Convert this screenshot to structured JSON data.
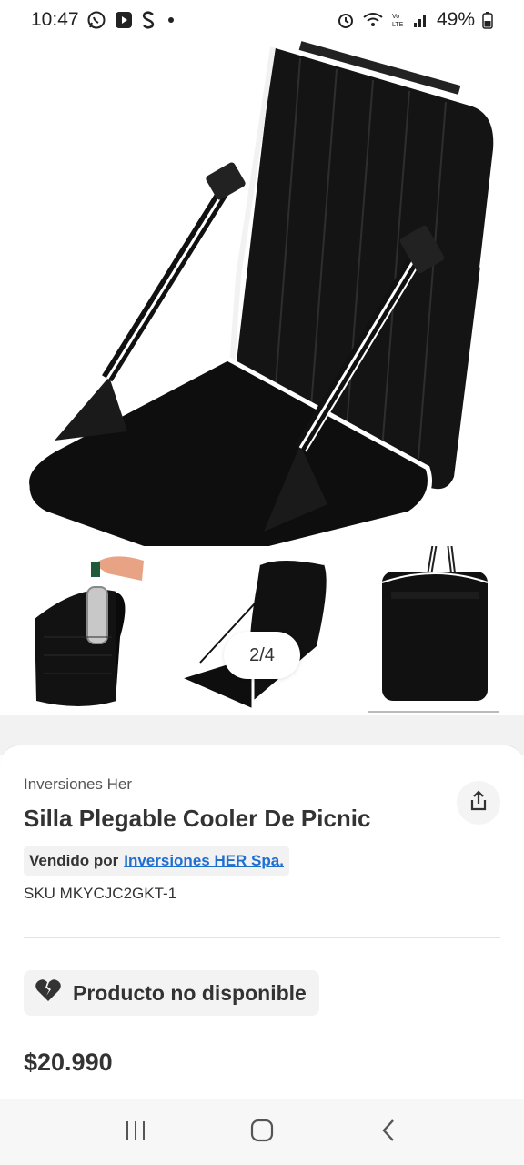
{
  "status_bar": {
    "time": "10:47",
    "battery_percent": "49%",
    "icons_left": [
      "whatsapp-icon",
      "play-icon",
      "s-app-icon",
      "notification-dot"
    ],
    "icons_right": [
      "alarm-icon",
      "wifi-icon",
      "volte-icon",
      "signal-icon",
      "battery-icon"
    ]
  },
  "gallery": {
    "counter": "2/4",
    "current_index": 2,
    "total": 4,
    "thumbnails": [
      "thumbnail-1",
      "thumbnail-2",
      "thumbnail-3"
    ]
  },
  "product": {
    "brand": "Inversiones Her",
    "title": "Silla Plegable Cooler De Picnic",
    "seller_label": "Vendido por",
    "seller_name": "Inversiones HER Spa.",
    "sku": "SKU MKYCJC2GKT-1",
    "availability": "Producto no disponible",
    "price": "$20.990"
  },
  "colors": {
    "link": "#1f6fd1",
    "text": "#333333",
    "chip_bg": "#f2f2f2"
  },
  "navbar": {
    "items": [
      "recent-apps-icon",
      "home-icon",
      "back-icon"
    ]
  }
}
